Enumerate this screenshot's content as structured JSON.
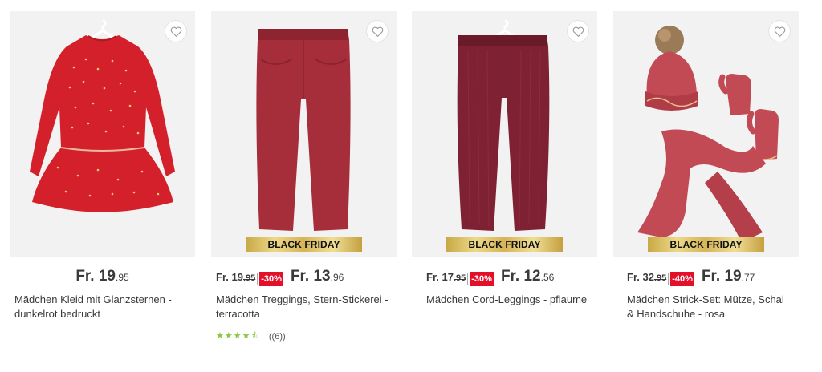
{
  "products": [
    {
      "price_main": "Fr. 19",
      "price_cents": ".95",
      "title": "Mädchen Kleid mit Glanzsternen - dunkelrot bedruckt",
      "wishlist_icon": "heart-outline-icon"
    },
    {
      "badge": "BLACK FRIDAY",
      "old_main": "Fr. 19",
      "old_cents": ".95",
      "discount": "-30%",
      "price_main": "Fr. 13",
      "price_cents": ".96",
      "title": "Mädchen Treggings, Stern-Stickerei - terracotta",
      "rating_value": 4.5,
      "rating_count": "((6))",
      "wishlist_icon": "heart-outline-icon"
    },
    {
      "badge": "BLACK FRIDAY",
      "old_main": "Fr. 17",
      "old_cents": ".95",
      "discount": "-30%",
      "price_main": "Fr. 12",
      "price_cents": ".56",
      "title": "Mädchen Cord-Leggings - pflaume",
      "wishlist_icon": "heart-outline-icon"
    },
    {
      "badge": "BLACK FRIDAY",
      "old_main": "Fr. 32",
      "old_cents": ".95",
      "discount": "-40%",
      "price_main": "Fr. 19",
      "price_cents": ".77",
      "title": "Mädchen Strick-Set: Mütze, Schal & Handschuhe - rosa",
      "wishlist_icon": "heart-outline-icon"
    }
  ],
  "colors": {
    "discount_red": "#e3102a",
    "badge_gold": "#d6b458",
    "star_green": "#8cc63f",
    "photo_bg": "#f2f2f2",
    "dress_red": "#d3202a",
    "treggings": "#a62e3b",
    "leggings": "#7e2233",
    "knit_set": "#c24a55"
  }
}
